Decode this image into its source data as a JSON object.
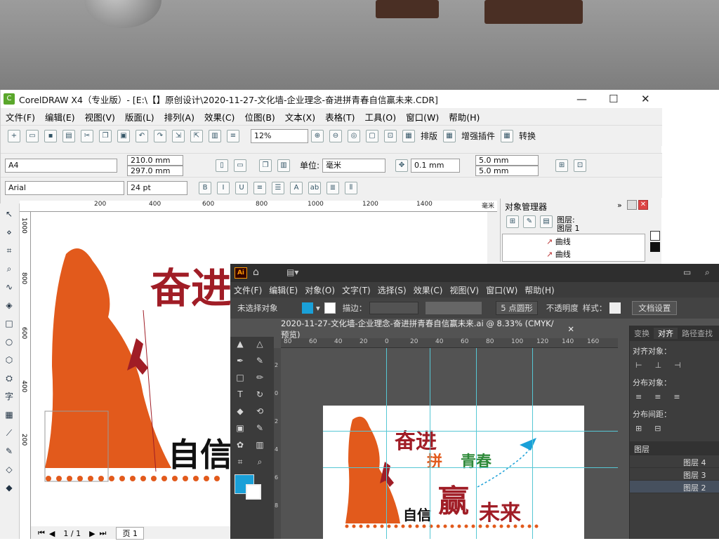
{
  "colors": {
    "orange": "#e25a1c",
    "darkred": "#a01d26",
    "green": "#2f8a3a",
    "cyan": "#1aa0d8"
  },
  "corel": {
    "title": "CorelDRAW X4（专业版）- [E:\\【】原创设计\\2020-11-27-文化墙-企业理念-奋进拼青春自信赢未来.CDR]",
    "menu": [
      "文件(F)",
      "编辑(E)",
      "视图(V)",
      "版面(L)",
      "排列(A)",
      "效果(C)",
      "位图(B)",
      "文本(X)",
      "表格(T)",
      "工具(O)",
      "窗口(W)",
      "帮助(H)"
    ],
    "zoom": "12%",
    "std_buttons": [
      "排版",
      "增强插件",
      "转换"
    ],
    "page_size": "A4",
    "width": "210.0 mm",
    "height": "297.0 mm",
    "unit_label": "单位:",
    "unit": "毫米",
    "nudge": "0.1 mm",
    "dup_x": "5.0 mm",
    "dup_y": "5.0 mm",
    "font": "Arial",
    "font_size": "24 pt",
    "hruler": [
      "200",
      "400",
      "600",
      "800",
      "1000",
      "1200",
      "1400"
    ],
    "hruler_unit": "毫米",
    "vruler": [
      "1000",
      "800",
      "600",
      "400",
      "200"
    ],
    "docker_title": "对象管理器",
    "layer_a": "图层:",
    "layer_b": "图层 1",
    "items": [
      "曲线",
      "曲线"
    ],
    "page_nav": "1 / 1",
    "page_tab": "页 1",
    "canvas_text1": "奋进",
    "canvas_text2": "自信"
  },
  "ai": {
    "logo": "Ai",
    "menu": [
      "文件(F)",
      "编辑(E)",
      "对象(O)",
      "文字(T)",
      "选择(S)",
      "效果(C)",
      "视图(V)",
      "窗口(W)",
      "帮助(H)"
    ],
    "no_selection": "未选择对象",
    "stroke_label": "描边：",
    "brush": "5 点圆形",
    "opacity": "不透明度",
    "style": "样式：",
    "doc_settings": "文档设置",
    "tab_title": "2020-11-27-文化墙-企业理念-奋进拼青春自信赢未来.ai @ 8.33% (CMYK/预览)",
    "ruler": [
      "80",
      "60",
      "40",
      "20",
      "0",
      "20",
      "40",
      "60",
      "80",
      "100",
      "120",
      "140",
      "160"
    ],
    "vruler": [
      "2",
      "0",
      "2",
      "4",
      "6",
      "8"
    ],
    "panel_tabs": [
      "变换",
      "对齐",
      "路径查找"
    ],
    "align_objects": "对齐对象：",
    "distribute_objects": "分布对象：",
    "distribute_spacing": "分布间距：",
    "layers_title": "图层",
    "layers": [
      "图层 4",
      "图层 3",
      "图层 2"
    ],
    "art": {
      "t1": "奋进",
      "t2": "拼",
      "t3": "青春",
      "t4": "自信",
      "t5": "赢",
      "t6": "未来"
    }
  }
}
